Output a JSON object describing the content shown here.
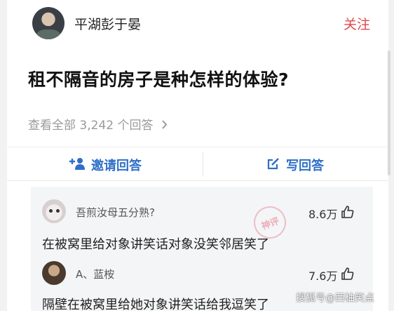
{
  "header": {
    "author_name": "平湖彭于晏",
    "follow_label": "关注"
  },
  "question": {
    "title": "租不隔音的房子是种怎样的体验?",
    "view_all": "查看全部 3,242 个回答"
  },
  "actions": {
    "invite_label": "邀请回答",
    "write_label": "写回答"
  },
  "comments": [
    {
      "user": "吾煎汝母五分熟?",
      "likes": "8.6万",
      "text": "在被窝里给对象讲笑话对象没笑邻居笑了"
    },
    {
      "user": "A、蓝桉",
      "likes": "7.6万",
      "text": "隔壁在被窝里给她对象讲笑话给我逗笑了"
    }
  ],
  "stamp_text": "神评",
  "watermark": "搜狐号@西柚笑点",
  "colors": {
    "accent_red": "#e0484f",
    "link_blue": "#2f6fc7",
    "muted_gray": "#9a9a9a",
    "comment_bg": "#f4f5f7"
  },
  "icons": [
    "add-user-icon",
    "edit-icon",
    "chevron-right-icon",
    "thumbs-up-icon"
  ]
}
